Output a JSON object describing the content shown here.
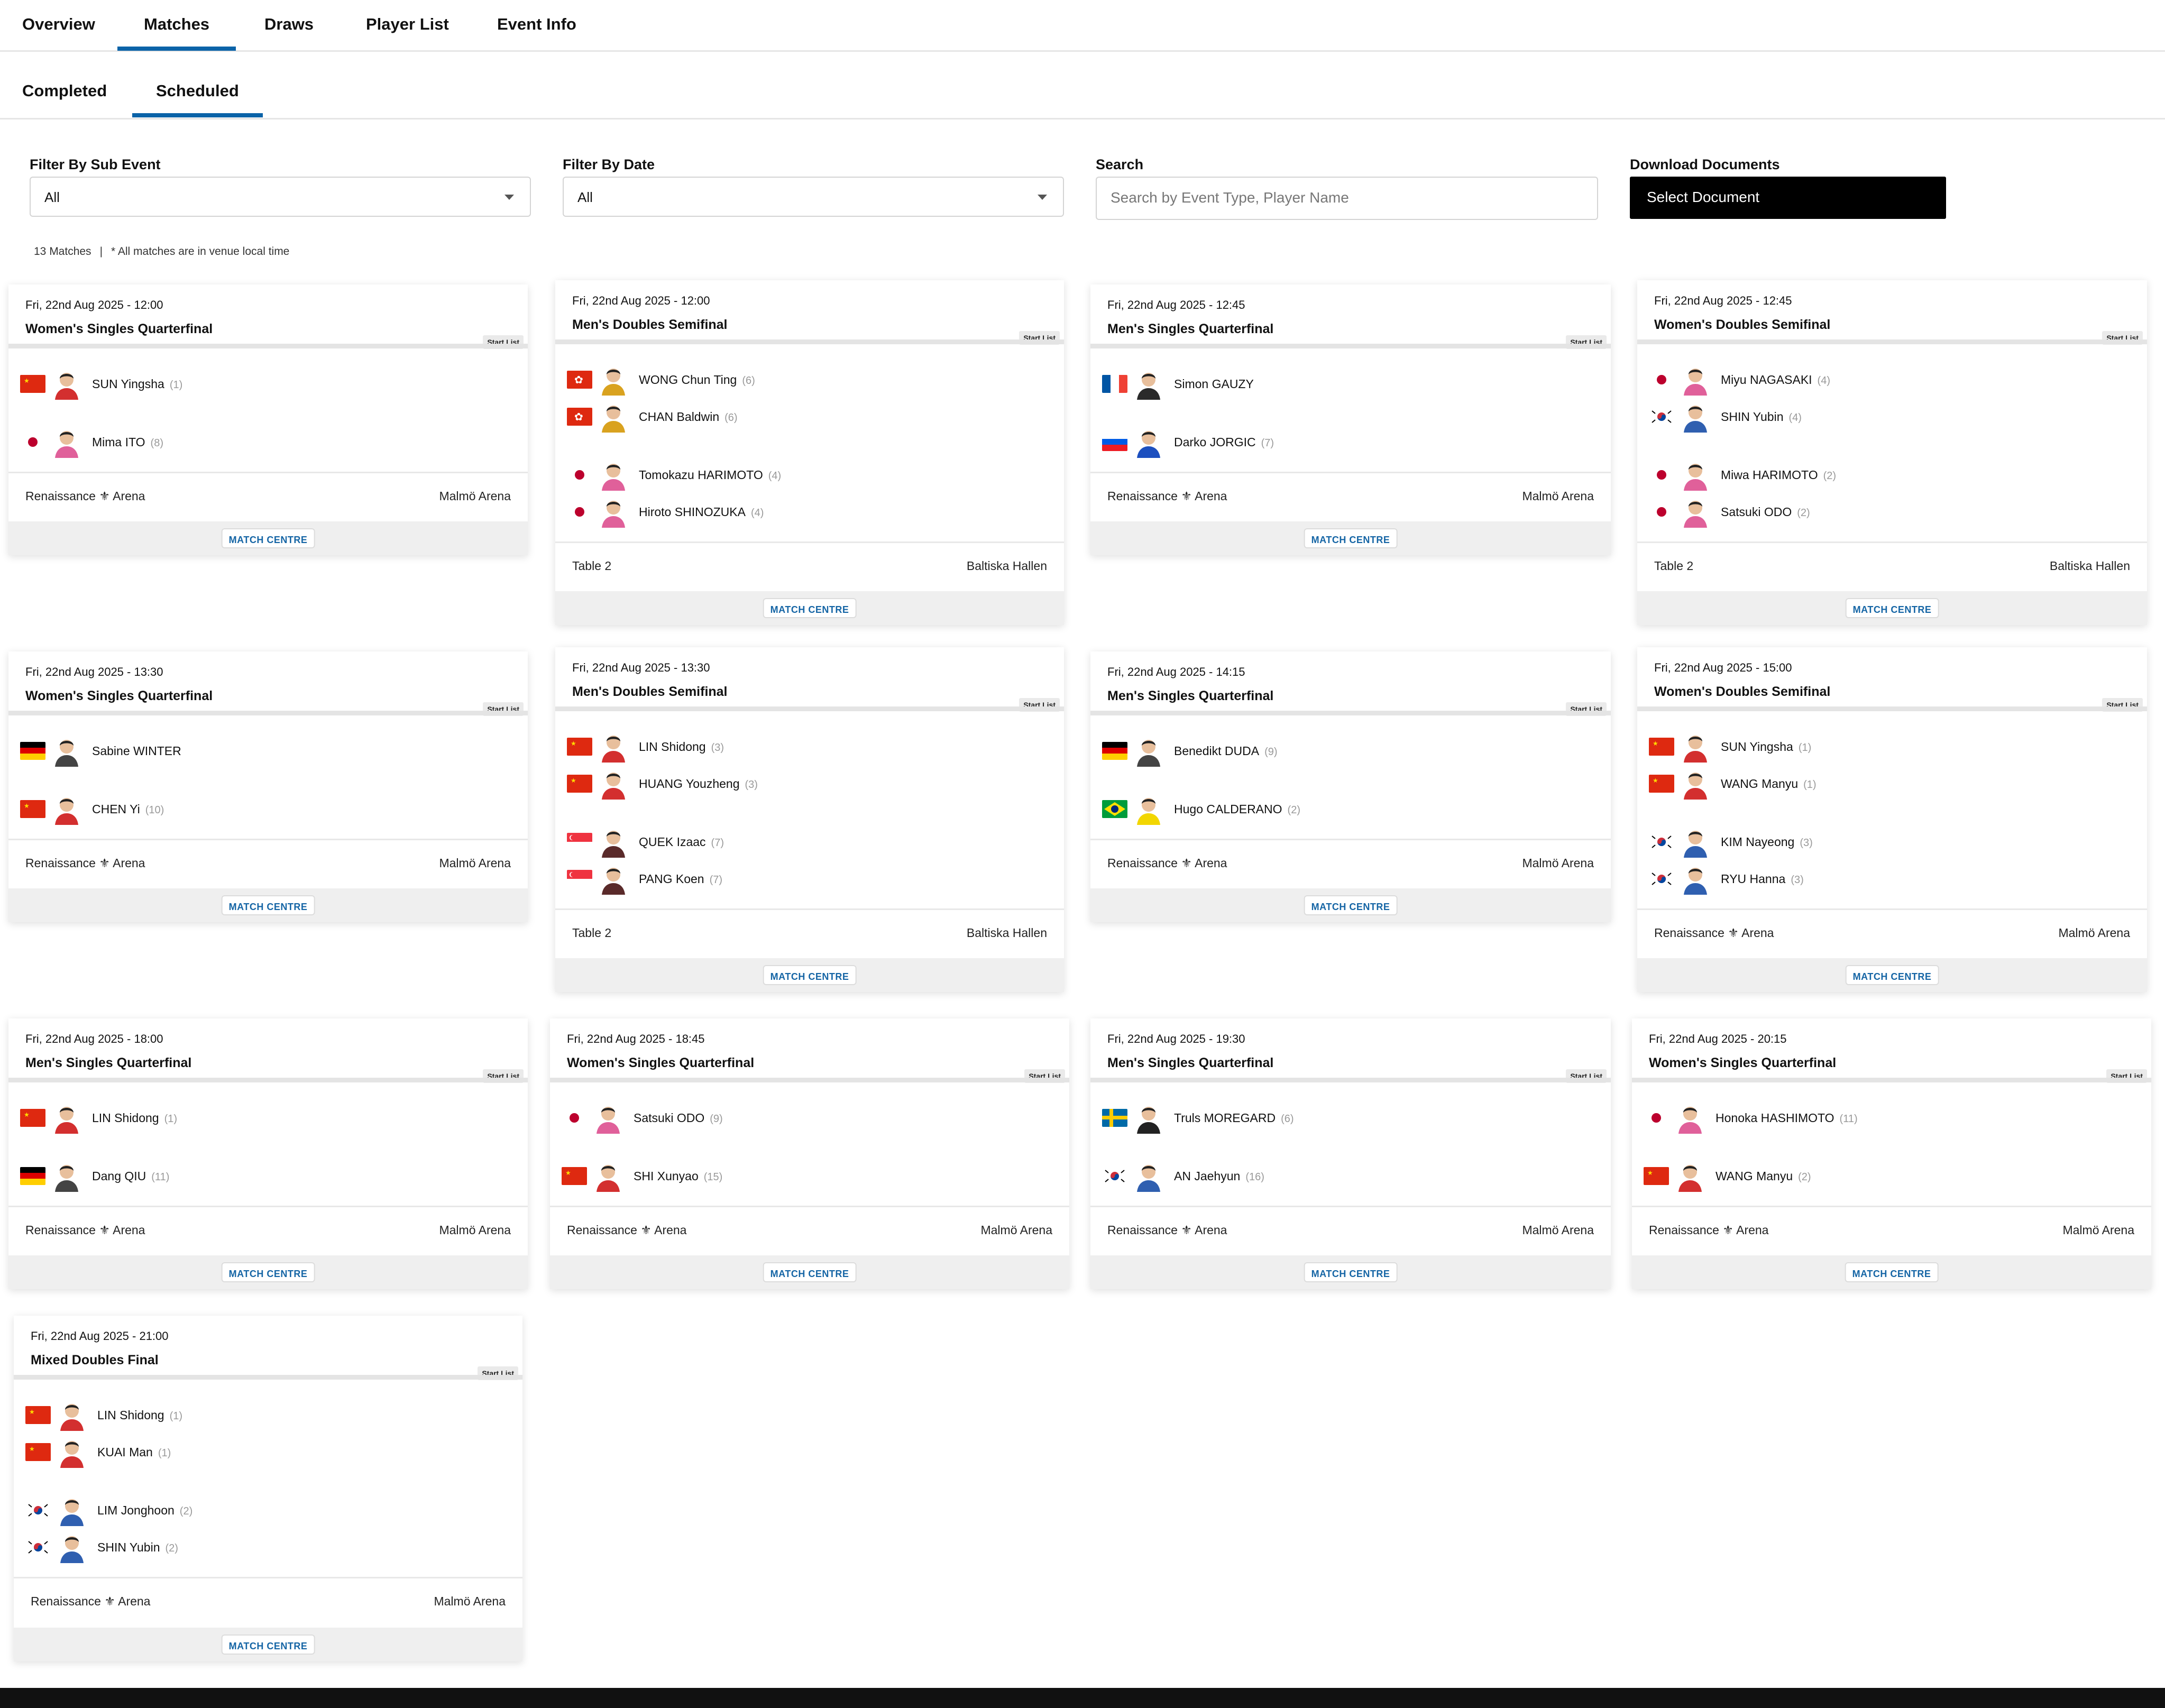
{
  "nav": {
    "tabs": [
      "Overview",
      "Matches",
      "Draws",
      "Player List",
      "Event Info"
    ],
    "active": "Matches"
  },
  "subnav": {
    "tabs": [
      "Completed",
      "Scheduled"
    ],
    "active": "Scheduled"
  },
  "filters": {
    "sub_event_label": "Filter By Sub Event",
    "sub_event_value": "All",
    "date_label": "Filter By Date",
    "date_value": "All",
    "search_label": "Search",
    "search_placeholder": "Search by Event Type, Player Name",
    "download_label": "Download Documents",
    "download_button": "Select Document"
  },
  "meta": {
    "count": "13 Matches",
    "note": "* All matches are in venue local time"
  },
  "labels": {
    "start_list": "Start List",
    "match_centre": "MATCH CENTRE"
  },
  "matches": [
    {
      "datetime": "Fri, 22nd Aug 2025 - 12:00",
      "event": "Women's Singles Quarterfinal",
      "venue": "Renaissance ⚜ Arena",
      "city": "Malmö Arena",
      "players": [
        {
          "name": "SUN Yingsha",
          "seed": "(1)",
          "flag": "china"
        },
        {
          "name": "Mima ITO",
          "seed": "(8)",
          "flag": "japan"
        }
      ]
    },
    {
      "datetime": "Fri, 22nd Aug 2025 - 12:00",
      "event": "Men's Doubles Semifinal",
      "venue": "Table 2",
      "city": "Baltiska Hallen",
      "players": [
        {
          "name": "WONG Chun Ting",
          "seed": "(6)",
          "flag": "hongkong"
        },
        {
          "name": "CHAN Baldwin",
          "seed": "(6)",
          "flag": "hongkong"
        },
        {
          "name": "Tomokazu HARIMOTO",
          "seed": "(4)",
          "flag": "japan"
        },
        {
          "name": "Hiroto SHINOZUKA",
          "seed": "(4)",
          "flag": "japan"
        }
      ]
    },
    {
      "datetime": "Fri, 22nd Aug 2025 - 12:45",
      "event": "Men's Singles Quarterfinal",
      "venue": "Renaissance ⚜ Arena",
      "city": "Malmö Arena",
      "players": [
        {
          "name": "Simon GAUZY",
          "seed": "",
          "flag": "france"
        },
        {
          "name": "Darko JORGIC",
          "seed": "(7)",
          "flag": "slovenia"
        }
      ]
    },
    {
      "datetime": "Fri, 22nd Aug 2025 - 12:45",
      "event": "Women's Doubles Semifinal",
      "venue": "Table 2",
      "city": "Baltiska Hallen",
      "players": [
        {
          "name": "Miyu NAGASAKI",
          "seed": "(4)",
          "flag": "japan"
        },
        {
          "name": "SHIN Yubin",
          "seed": "(4)",
          "flag": "korea"
        },
        {
          "name": "Miwa HARIMOTO",
          "seed": "(2)",
          "flag": "japan"
        },
        {
          "name": "Satsuki ODO",
          "seed": "(2)",
          "flag": "japan"
        }
      ]
    },
    {
      "datetime": "Fri, 22nd Aug 2025 - 13:30",
      "event": "Women's Singles Quarterfinal",
      "venue": "Renaissance ⚜ Arena",
      "city": "Malmö Arena",
      "players": [
        {
          "name": "Sabine WINTER",
          "seed": "",
          "flag": "germany"
        },
        {
          "name": "CHEN Yi",
          "seed": "(10)",
          "flag": "china"
        }
      ]
    },
    {
      "datetime": "Fri, 22nd Aug 2025 - 13:30",
      "event": "Men's Doubles Semifinal",
      "venue": "Table 2",
      "city": "Baltiska Hallen",
      "players": [
        {
          "name": "LIN Shidong",
          "seed": "(3)",
          "flag": "china"
        },
        {
          "name": "HUANG Youzheng",
          "seed": "(3)",
          "flag": "china"
        },
        {
          "name": "QUEK Izaac",
          "seed": "(7)",
          "flag": "singapore"
        },
        {
          "name": "PANG Koen",
          "seed": "(7)",
          "flag": "singapore"
        }
      ]
    },
    {
      "datetime": "Fri, 22nd Aug 2025 - 14:15",
      "event": "Men's Singles Quarterfinal",
      "venue": "Renaissance ⚜ Arena",
      "city": "Malmö Arena",
      "players": [
        {
          "name": "Benedikt DUDA",
          "seed": "(9)",
          "flag": "germany"
        },
        {
          "name": "Hugo CALDERANO",
          "seed": "(2)",
          "flag": "brazil"
        }
      ]
    },
    {
      "datetime": "Fri, 22nd Aug 2025 - 15:00",
      "event": "Women's Doubles Semifinal",
      "venue": "Renaissance ⚜ Arena",
      "city": "Malmö Arena",
      "players": [
        {
          "name": "SUN Yingsha",
          "seed": "(1)",
          "flag": "china"
        },
        {
          "name": "WANG Manyu",
          "seed": "(1)",
          "flag": "china"
        },
        {
          "name": "KIM Nayeong",
          "seed": "(3)",
          "flag": "korea"
        },
        {
          "name": "RYU Hanna",
          "seed": "(3)",
          "flag": "korea"
        }
      ]
    },
    {
      "datetime": "Fri, 22nd Aug 2025 - 18:00",
      "event": "Men's Singles Quarterfinal",
      "venue": "Renaissance ⚜ Arena",
      "city": "Malmö Arena",
      "players": [
        {
          "name": "LIN Shidong",
          "seed": "(1)",
          "flag": "china"
        },
        {
          "name": "Dang QIU",
          "seed": "(11)",
          "flag": "germany"
        }
      ]
    },
    {
      "datetime": "Fri, 22nd Aug 2025 - 18:45",
      "event": "Women's Singles Quarterfinal",
      "venue": "Renaissance ⚜ Arena",
      "city": "Malmö Arena",
      "players": [
        {
          "name": "Satsuki ODO",
          "seed": "(9)",
          "flag": "japan"
        },
        {
          "name": "SHI Xunyao",
          "seed": "(15)",
          "flag": "china"
        }
      ]
    },
    {
      "datetime": "Fri, 22nd Aug 2025 - 19:30",
      "event": "Men's Singles Quarterfinal",
      "venue": "Renaissance ⚜ Arena",
      "city": "Malmö Arena",
      "players": [
        {
          "name": "Truls MOREGARD",
          "seed": "(6)",
          "flag": "sweden"
        },
        {
          "name": "AN Jaehyun",
          "seed": "(16)",
          "flag": "korea"
        }
      ]
    },
    {
      "datetime": "Fri, 22nd Aug 2025 - 20:15",
      "event": "Women's Singles Quarterfinal",
      "venue": "Renaissance ⚜ Arena",
      "city": "Malmö Arena",
      "players": [
        {
          "name": "Honoka HASHIMOTO",
          "seed": "(11)",
          "flag": "japan"
        },
        {
          "name": "WANG Manyu",
          "seed": "(2)",
          "flag": "china"
        }
      ]
    },
    {
      "datetime": "Fri, 22nd Aug 2025 - 21:00",
      "event": "Mixed Doubles Final",
      "venue": "Renaissance ⚜ Arena",
      "city": "Malmö Arena",
      "players": [
        {
          "name": "LIN Shidong",
          "seed": "(1)",
          "flag": "china"
        },
        {
          "name": "KUAI Man",
          "seed": "(1)",
          "flag": "china"
        },
        {
          "name": "LIM Jonghoon",
          "seed": "(2)",
          "flag": "korea"
        },
        {
          "name": "SHIN Yubin",
          "seed": "(2)",
          "flag": "korea"
        }
      ]
    }
  ],
  "colors": {
    "accent": "#0b63a8",
    "match_centre_text": "#1565a5",
    "download_button_bg": "#000000"
  }
}
